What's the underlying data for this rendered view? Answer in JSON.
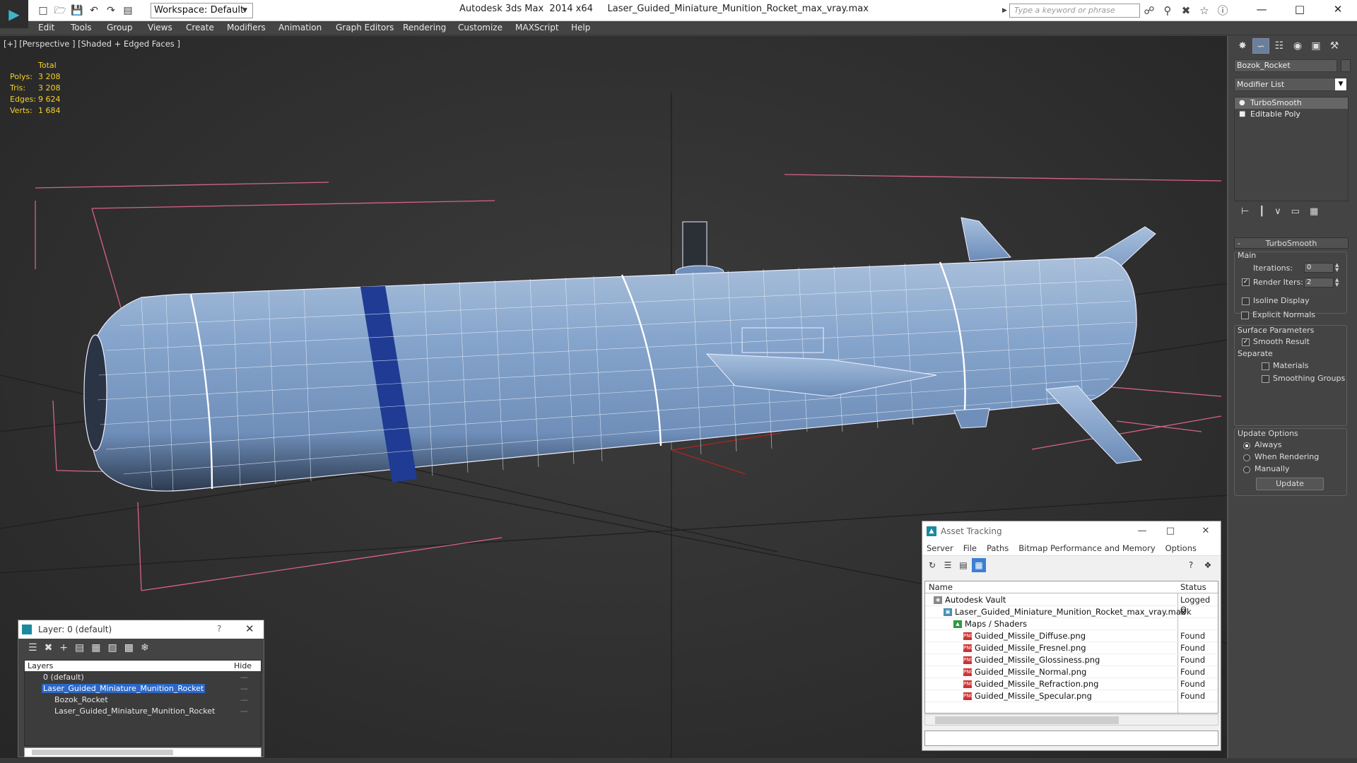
{
  "app": {
    "title": "Autodesk 3ds Max  2014 x64     Laser_Guided_Miniature_Munition_Rocket_max_vray.max",
    "workspace": "Workspace: Default",
    "search_placeholder": "Type a keyword or phrase"
  },
  "menu": [
    "Edit",
    "Tools",
    "Group",
    "Views",
    "Create",
    "Modifiers",
    "Animation",
    "Graph Editors",
    "Rendering",
    "Customize",
    "MAXScript",
    "Help"
  ],
  "viewport": {
    "label": "[+] [Perspective ] [Shaded + Edged Faces ]",
    "stats_header": "Total",
    "stats": [
      {
        "k": "Polys:",
        "v": "3 208"
      },
      {
        "k": "Tris:",
        "v": "3 208"
      },
      {
        "k": "Edges:",
        "v": "9 624"
      },
      {
        "k": "Verts:",
        "v": "1 684"
      }
    ],
    "colors": {
      "mesh": "#7d9dc7",
      "stripe": "#1f3b93",
      "bbox": "#d7628e"
    }
  },
  "cmdpanel": {
    "object_name": "Bozok_Rocket",
    "modifier_list": "Modifier List",
    "stack": [
      "TurboSmooth",
      "Editable Poly"
    ],
    "rollout_title": "TurboSmooth",
    "main_label": "Main",
    "iterations_label": "Iterations:",
    "iterations_value": "0",
    "render_iters_label": "Render Iters:",
    "render_iters_value": "2",
    "isoline_label": "Isoline Display",
    "explicit_label": "Explicit Normals",
    "surface_label": "Surface Parameters",
    "smooth_label": "Smooth Result",
    "separate_label": "Separate",
    "materials_label": "Materials",
    "smoothing_label": "Smoothing Groups",
    "update_options_label": "Update Options",
    "always_label": "Always",
    "when_rendering_label": "When Rendering",
    "manually_label": "Manually",
    "update_button": "Update"
  },
  "asset_tracking": {
    "title": "Asset Tracking",
    "menu": [
      "Server",
      "File",
      "Paths",
      "Bitmap Performance and Memory",
      "Options"
    ],
    "columns": {
      "name": "Name",
      "status": "Status"
    },
    "rows": [
      {
        "name": "Autodesk Vault",
        "status": "Logged O",
        "indent": 0,
        "icon": "vault-icon"
      },
      {
        "name": "Laser_Guided_Miniature_Munition_Rocket_max_vray.max",
        "status": "Ok",
        "indent": 1,
        "icon": "max-file-icon"
      },
      {
        "name": "Maps / Shaders",
        "status": "",
        "indent": 2,
        "icon": "maps-icon"
      },
      {
        "name": "Guided_Missile_Diffuse.png",
        "status": "Found",
        "indent": 3,
        "icon": "png-icon"
      },
      {
        "name": "Guided_Missile_Fresnel.png",
        "status": "Found",
        "indent": 3,
        "icon": "png-icon"
      },
      {
        "name": "Guided_Missile_Glossiness.png",
        "status": "Found",
        "indent": 3,
        "icon": "png-icon"
      },
      {
        "name": "Guided_Missile_Normal.png",
        "status": "Found",
        "indent": 3,
        "icon": "png-icon"
      },
      {
        "name": "Guided_Missile_Refraction.png",
        "status": "Found",
        "indent": 3,
        "icon": "png-icon"
      },
      {
        "name": "Guided_Missile_Specular.png",
        "status": "Found",
        "indent": 3,
        "icon": "png-icon"
      }
    ]
  },
  "layer_window": {
    "title": "Layer: 0 (default)",
    "help": "?",
    "col_layers": "Layers",
    "col_hide": "Hide",
    "rows": [
      {
        "name": "0 (default)",
        "indent": 0,
        "selected": false
      },
      {
        "name": "Laser_Guided_Miniature_Munition_Rocket",
        "indent": 0,
        "selected": true
      },
      {
        "name": "Bozok_Rocket",
        "indent": 1,
        "selected": false
      },
      {
        "name": "Laser_Guided_Miniature_Munition_Rocket",
        "indent": 1,
        "selected": false
      }
    ]
  }
}
